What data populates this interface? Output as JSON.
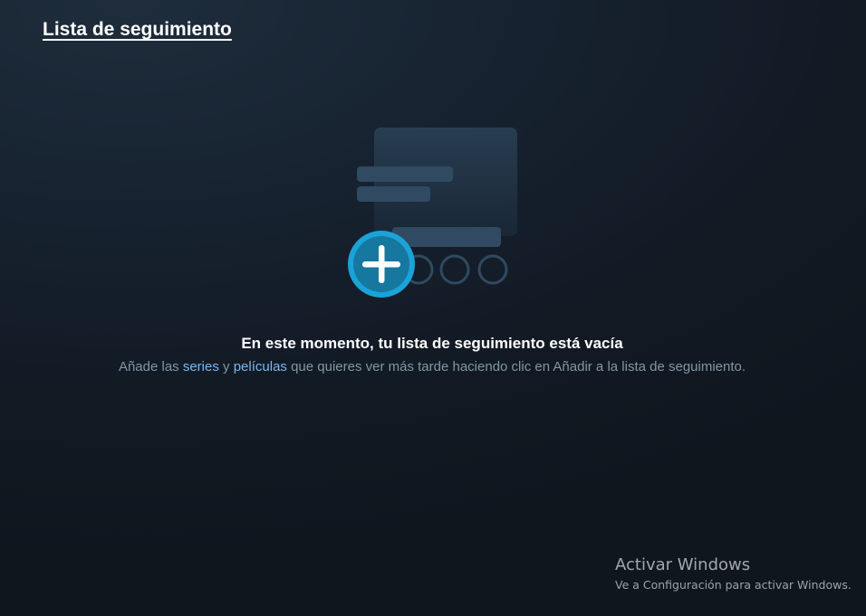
{
  "page": {
    "title": "Lista de seguimiento"
  },
  "empty_state": {
    "heading": "En este momento, tu lista de seguimiento está vacía",
    "desc_part1": "Añade las ",
    "series_link": "series",
    "desc_part2": " y ",
    "movies_link": "películas",
    "desc_part3": " que quieres ver más tarde haciendo clic en Añadir a la lista de seguimiento.",
    "illustration_icons": [
      "watchlist-card-icon",
      "add-circle-icon"
    ]
  },
  "windows_watermark": {
    "title": "Activar Windows",
    "subtitle": "Ve a Configuración para activar Windows."
  },
  "colors": {
    "accent": "#1aa3d9",
    "link": "#79b8f3",
    "muted_text": "#8197a4",
    "illustration_shape": "#2a4256"
  }
}
